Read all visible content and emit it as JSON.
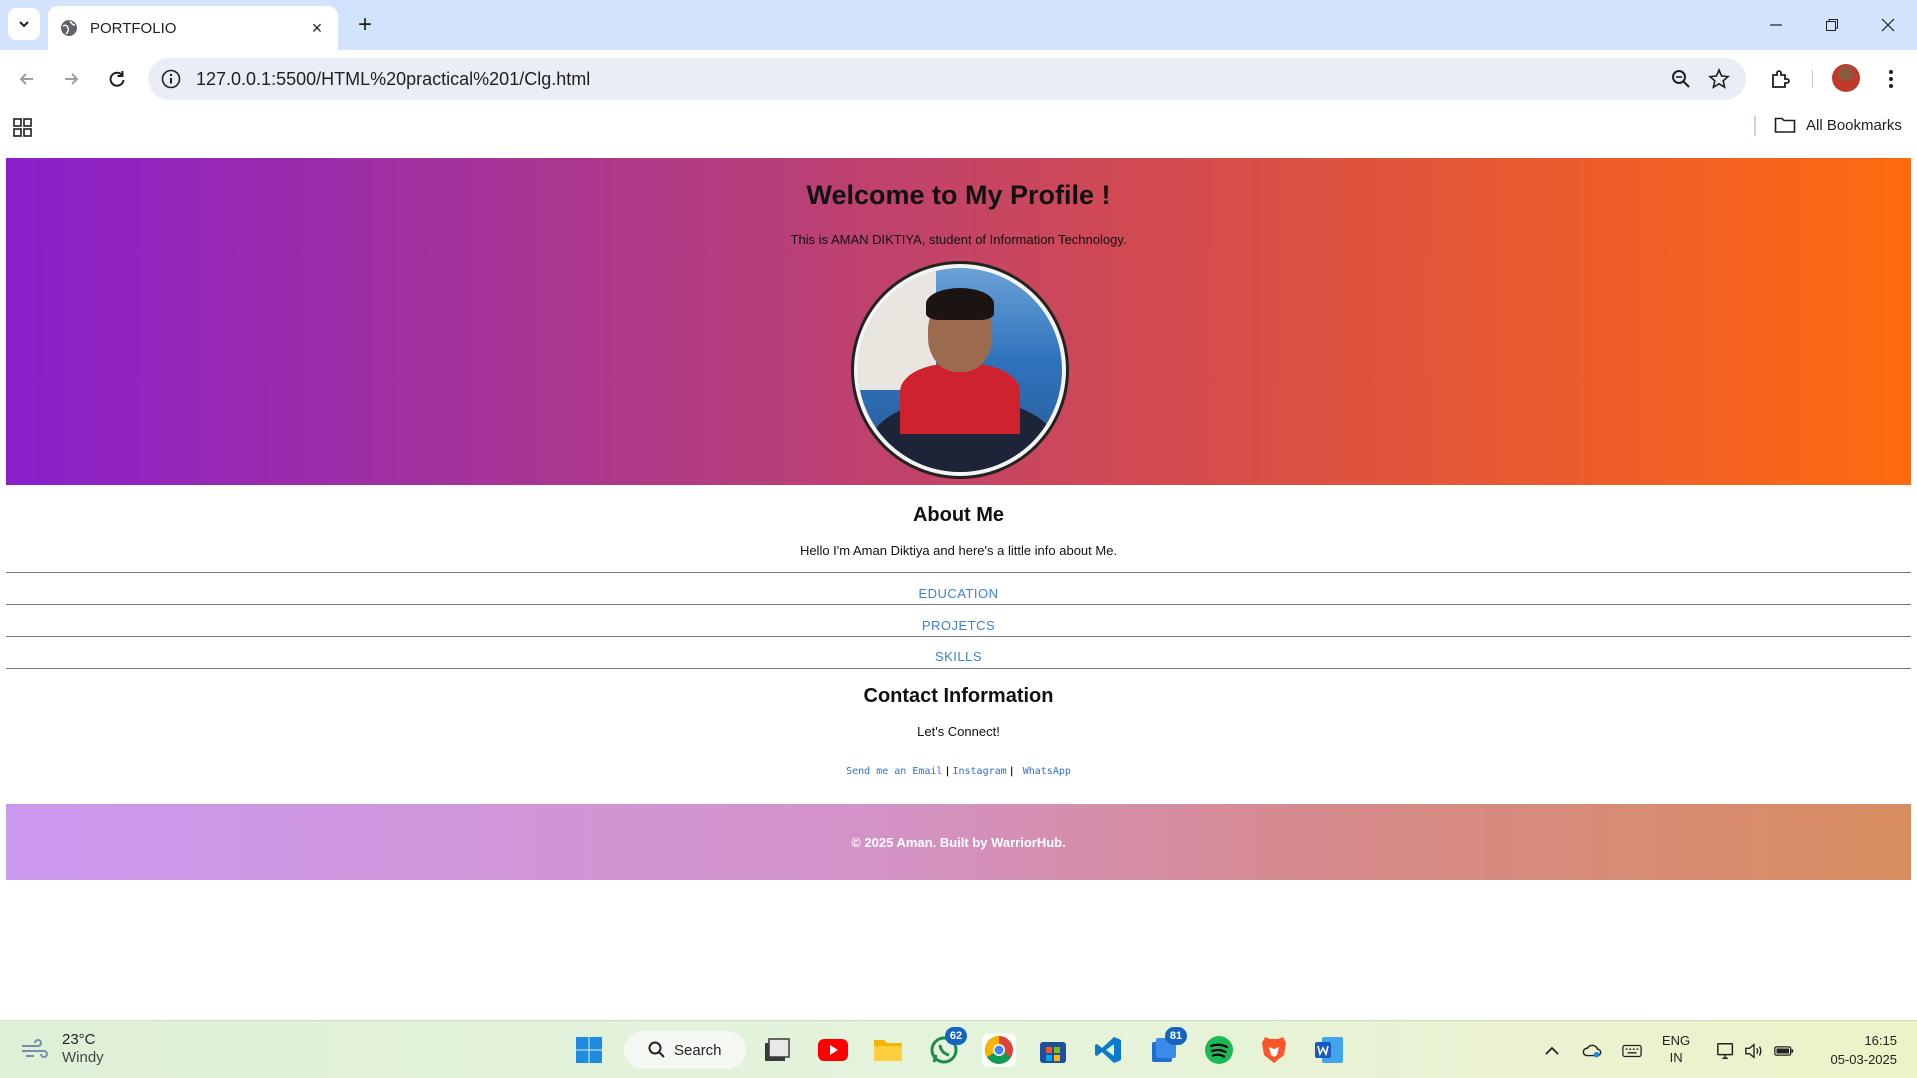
{
  "browser": {
    "tab": {
      "title": "PORTFOLIO",
      "close_label": "×"
    },
    "new_tab_label": "+",
    "address": "127.0.0.1:5500/HTML%20practical%201/Clg.html",
    "bookmarks_label": "All Bookmarks"
  },
  "page": {
    "hero": {
      "title": "Welcome to My Profile !",
      "subtitle": "This is AMAN DIKTIYA, student of Information Technology."
    },
    "about": {
      "title": "About Me",
      "text": "Hello I'm Aman Diktiya and here's a little info about Me."
    },
    "nav": [
      "EDUCATION",
      "PROJETCS",
      "SKILLS"
    ],
    "contact": {
      "title": "Contact Information",
      "text": "Let's Connect!",
      "links": {
        "email": "Send me an Email",
        "sep1": "|",
        "instagram": "Instagram",
        "sep2": "|",
        "whatsapp": "WhatsApp"
      }
    },
    "footer": "© 2025 Aman. Built by WarriorHub.",
    "colors": {
      "link": "#3f7fd4",
      "hero_start": "#8a1fcc",
      "hero_end": "#ff6a10"
    }
  },
  "taskbar": {
    "weather": {
      "temp": "23°C",
      "condition": "Windy"
    },
    "search_label": "Search",
    "badges": {
      "whatsapp": "62",
      "todo": "81"
    },
    "lang": {
      "line1": "ENG",
      "line2": "IN"
    },
    "clock": {
      "time": "16:15",
      "date": "05-03-2025"
    }
  }
}
